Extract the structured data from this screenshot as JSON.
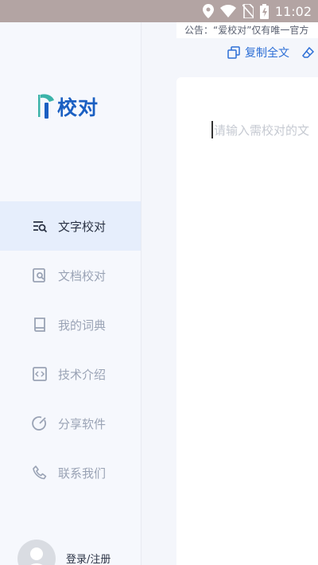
{
  "status_bar": {
    "time": "11:02",
    "icons": [
      "location-icon",
      "wifi-icon",
      "no-sim-icon",
      "battery-charging-icon"
    ]
  },
  "notice": {
    "text": "公告：“爱校对”仅有唯一官方"
  },
  "toolbar": {
    "copy_label": "复制全文"
  },
  "logo": {
    "text": "校对"
  },
  "nav": {
    "items": [
      {
        "label": "文字校对",
        "icon": "text-proofread-icon",
        "active": true
      },
      {
        "label": "文档校对",
        "icon": "document-search-icon",
        "active": false
      },
      {
        "label": "我的词典",
        "icon": "book-icon",
        "active": false
      },
      {
        "label": "技术介绍",
        "icon": "code-icon",
        "active": false
      },
      {
        "label": "分享软件",
        "icon": "share-icon",
        "active": false
      },
      {
        "label": "联系我们",
        "icon": "phone-icon",
        "active": false
      }
    ]
  },
  "user": {
    "login_label": "登录/注册"
  },
  "editor": {
    "placeholder": "请输入需校对的文"
  },
  "colors": {
    "accent": "#1a5fc2",
    "link": "#2d6fd6",
    "active_bg": "#e6eefc",
    "muted": "#9aa3b5"
  }
}
